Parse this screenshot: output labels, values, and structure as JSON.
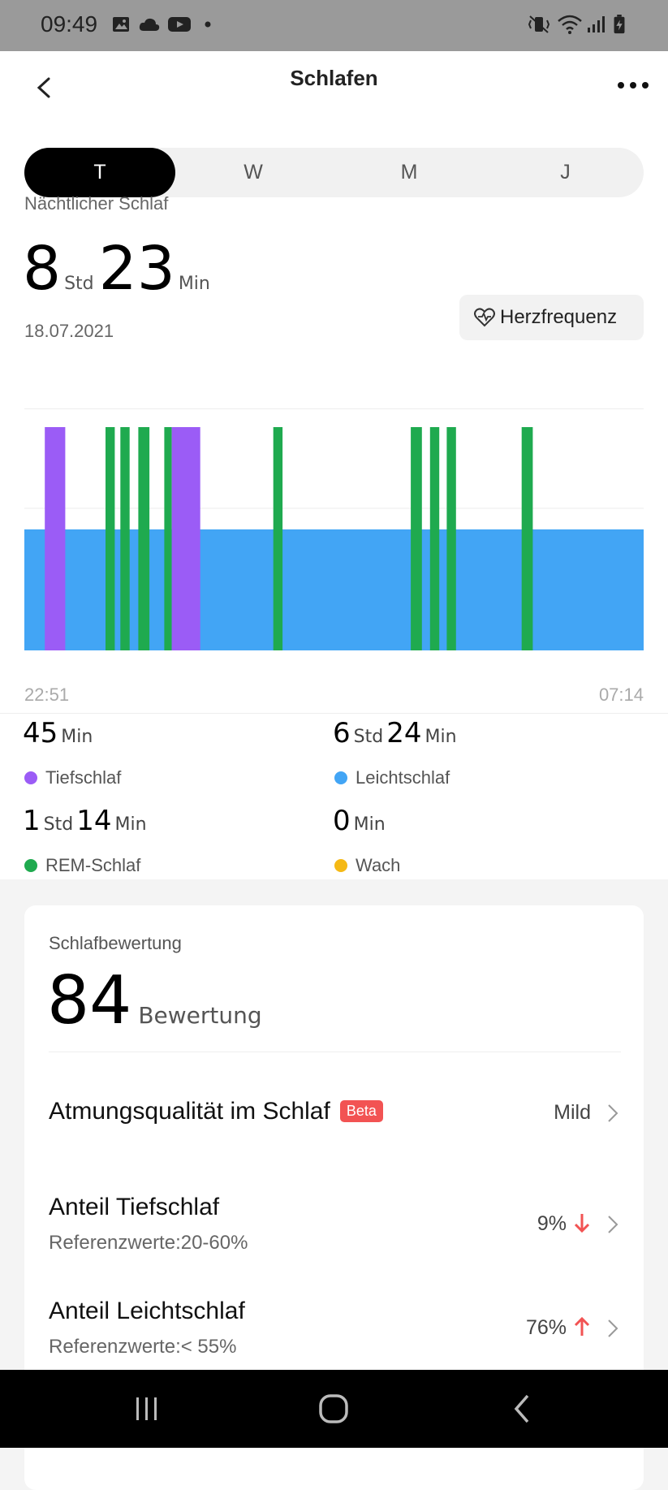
{
  "status_bar": {
    "time": "09:49",
    "left_icons": [
      "image-icon",
      "cloud-icon",
      "youtube-icon",
      "dot-icon"
    ],
    "right_icons": [
      "vibrate-mute-icon",
      "wifi-icon",
      "signal-icon",
      "battery-icon"
    ]
  },
  "header": {
    "title": "Schlafen",
    "back_icon": "chevron-left-icon",
    "more_icon": "more-horizontal-icon"
  },
  "period_tabs": [
    {
      "label": "T",
      "active": true
    },
    {
      "label": "W",
      "active": false
    },
    {
      "label": "M",
      "active": false
    },
    {
      "label": "J",
      "active": false
    }
  ],
  "summary": {
    "label": "Nächtlicher Schlaf",
    "hours": "8",
    "hours_unit": "Std",
    "minutes": "23",
    "minutes_unit": "Min",
    "date": "18.07.2021",
    "heart_rate_button": "Herzfrequenz"
  },
  "colors": {
    "deep": "#9b5cf6",
    "light": "#42a5f5",
    "rem": "#1faa4f",
    "awake": "#f5b915",
    "accent_red": "#f25353"
  },
  "chart_data": {
    "type": "bar",
    "start_label": "22:51",
    "end_label": "07:14",
    "baseline_stage": "Leichtschlaf",
    "segments": [
      {
        "stage": "Tiefschlaf",
        "start_pct": 3.3,
        "end_pct": 6.6
      },
      {
        "stage": "REM-Schlaf",
        "start_pct": 13.1,
        "end_pct": 14.6
      },
      {
        "stage": "REM-Schlaf",
        "start_pct": 15.5,
        "end_pct": 17.0
      },
      {
        "stage": "REM-Schlaf",
        "start_pct": 18.4,
        "end_pct": 20.2
      },
      {
        "stage": "REM-Schlaf",
        "start_pct": 22.6,
        "end_pct": 23.8
      },
      {
        "stage": "Tiefschlaf",
        "start_pct": 23.8,
        "end_pct": 28.4
      },
      {
        "stage": "REM-Schlaf",
        "start_pct": 40.2,
        "end_pct": 41.7
      },
      {
        "stage": "REM-Schlaf",
        "start_pct": 62.4,
        "end_pct": 64.2
      },
      {
        "stage": "REM-Schlaf",
        "start_pct": 65.5,
        "end_pct": 67.0
      },
      {
        "stage": "REM-Schlaf",
        "start_pct": 68.2,
        "end_pct": 69.7
      },
      {
        "stage": "REM-Schlaf",
        "start_pct": 80.3,
        "end_pct": 82.1
      }
    ]
  },
  "stats": {
    "deep": {
      "value_parts": [
        "45",
        "Min"
      ],
      "label": "Tiefschlaf"
    },
    "light": {
      "value_parts": [
        "6",
        "Std",
        "24",
        "Min"
      ],
      "label": "Leichtschlaf"
    },
    "rem": {
      "value_parts": [
        "1",
        "Std",
        "14",
        "Min"
      ],
      "label": "REM-Schlaf"
    },
    "awake": {
      "value_parts": [
        "0",
        "Min"
      ],
      "label": "Wach"
    }
  },
  "score_card": {
    "label": "Schlafbewertung",
    "score": "84",
    "score_word": "Bewertung",
    "rows": [
      {
        "title": "Atmungsqualität im Schlaf",
        "badge": "Beta",
        "value": "Mild"
      },
      {
        "title": "Anteil Tiefschlaf",
        "subtitle": "Referenzwerte:20-60%",
        "value": "9%",
        "trend": "down"
      },
      {
        "title": "Anteil Leichtschlaf",
        "subtitle": "Referenzwerte:< 55%",
        "value": "76%",
        "trend": "up"
      }
    ]
  },
  "nav_bar": {
    "icons": [
      "recent-apps-icon",
      "home-icon",
      "back-icon"
    ]
  }
}
